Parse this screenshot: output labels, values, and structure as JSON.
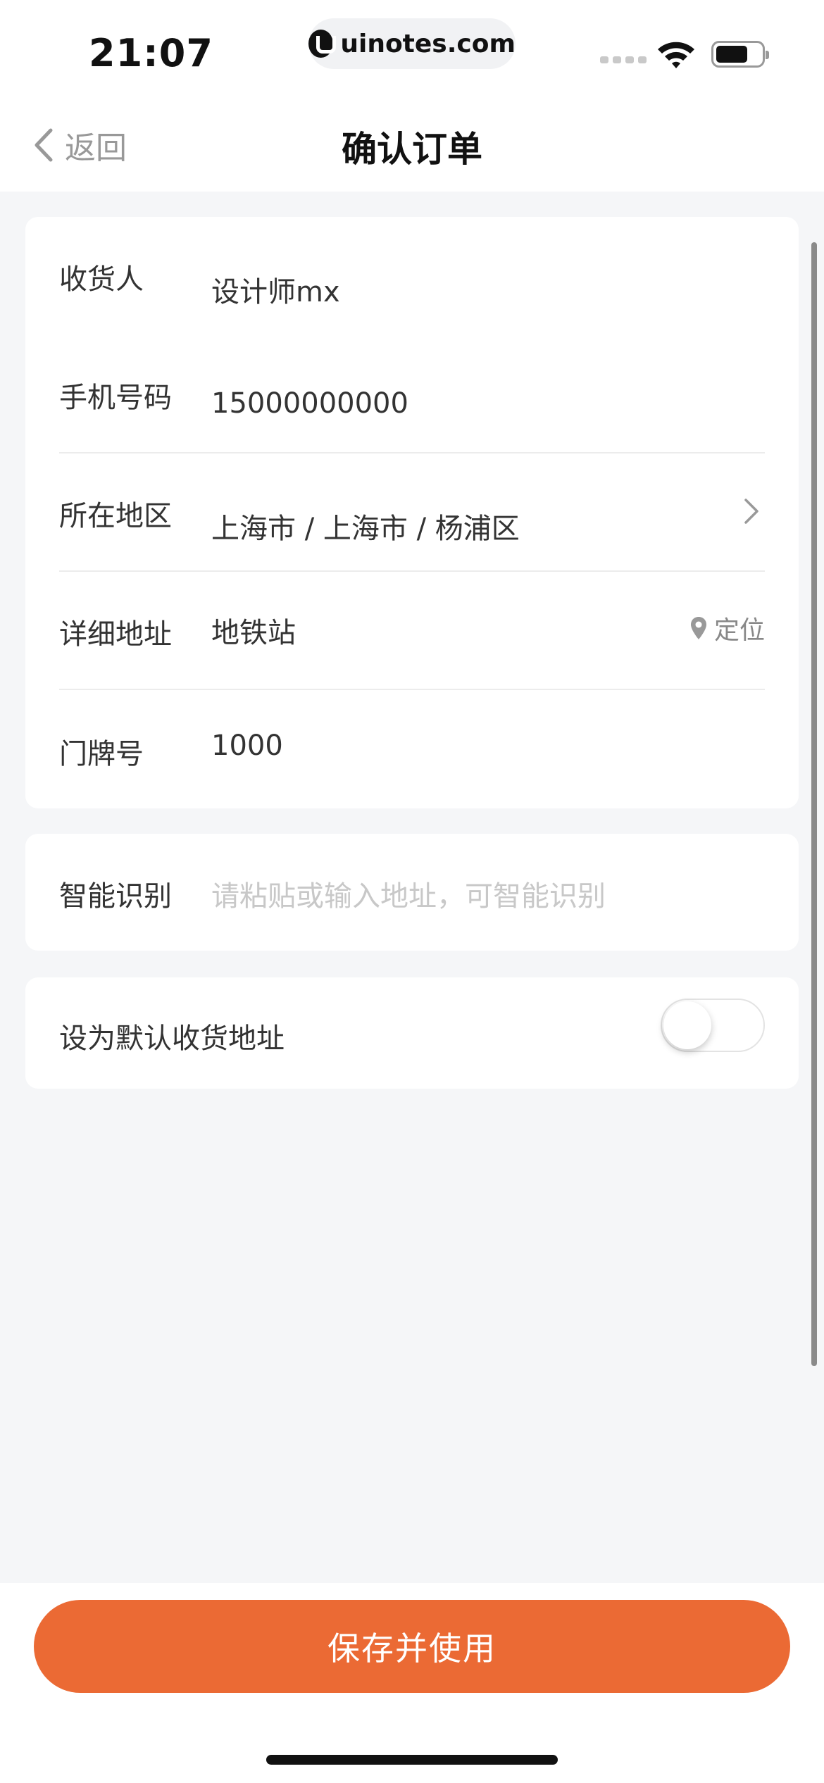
{
  "status_bar": {
    "time": "21:07",
    "url": "uinotes.com"
  },
  "nav": {
    "back_label": "返回",
    "title": "确认订单"
  },
  "form": {
    "recipient": {
      "label": "收货人",
      "value": "设计师mx"
    },
    "phone": {
      "label": "手机号码",
      "value": "15000000000"
    },
    "region": {
      "label": "所在地区",
      "value": "上海市 / 上海市 / 杨浦区"
    },
    "address": {
      "label": "详细地址",
      "value": "地铁站",
      "locate_label": "定位"
    },
    "house_number": {
      "label": "门牌号",
      "value": "1000"
    }
  },
  "smart_parse": {
    "label": "智能识别",
    "placeholder": "请粘贴或输入地址，可智能识别"
  },
  "default_address": {
    "label": "设为默认收货地址",
    "enabled": false
  },
  "submit_label": "保存并使用",
  "colors": {
    "accent": "#eb6a34",
    "background": "#f5f6f8",
    "card": "#ffffff",
    "placeholder": "#c8c8c8"
  }
}
